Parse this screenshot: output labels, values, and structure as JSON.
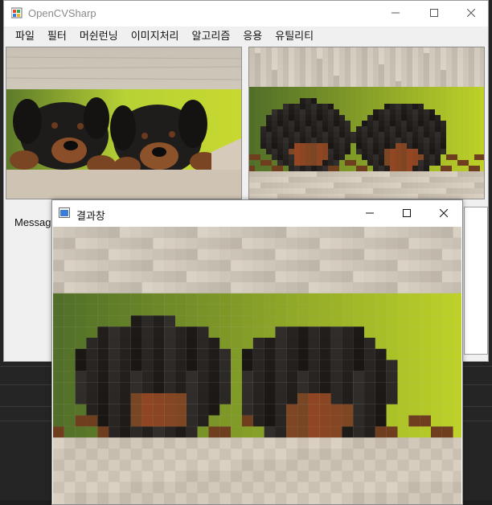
{
  "main_window": {
    "title": "OpenCVSharp",
    "menu": [
      "파일",
      "필터",
      "머쉰런닝",
      "이미지처리",
      "알고리즘",
      "응용",
      "유틸리티"
    ],
    "message_label": "Messag"
  },
  "result_window": {
    "title": "결과창"
  },
  "colors": {
    "title_inactive": "#8a8a8a",
    "window_bg": "#f0f0f0",
    "backdrop": "#252526"
  },
  "icons": {
    "app": "opencvsharp-app-icon",
    "result": "result-window-icon",
    "minimize": "minimize-icon",
    "maximize": "maximize-icon",
    "close": "close-icon"
  },
  "images": {
    "original": "two rottweiler puppies behind a wooden fence",
    "filtered": "same puppies with mosaic / pixelate effect",
    "result": "zoomed mosaic filtered puppies"
  }
}
